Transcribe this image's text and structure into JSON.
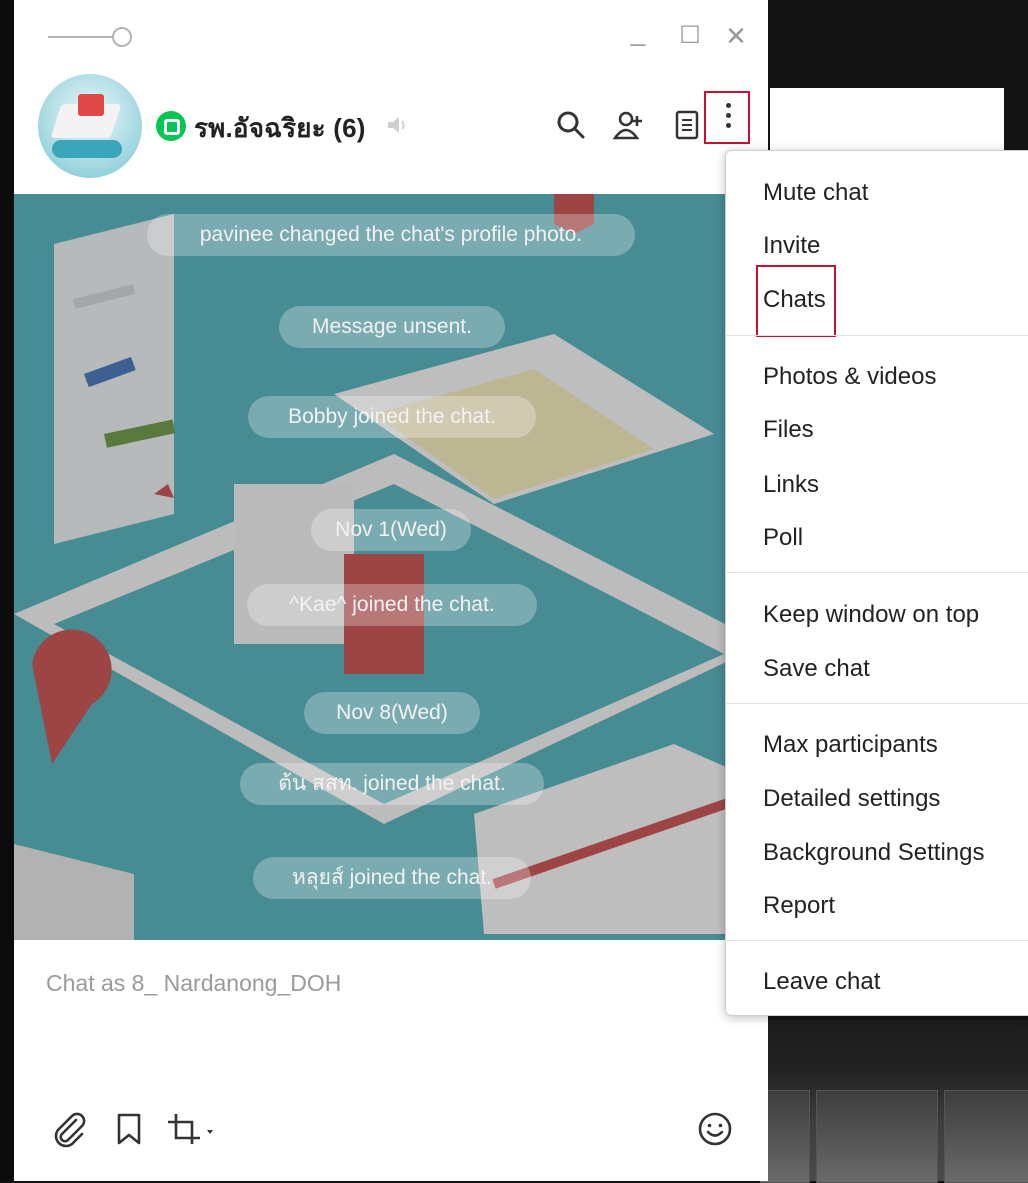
{
  "window": {
    "minimize_glyph": "_",
    "maximize_glyph": "☐",
    "close_glyph": "✕"
  },
  "header": {
    "title": "รพ.อัจฉริยะ (6)",
    "icons": [
      "search-icon",
      "add-member-icon",
      "notes-icon",
      "more-options-icon"
    ]
  },
  "messages": [
    {
      "text": "pavinee changed the chat's profile photo."
    },
    {
      "text": "Message unsent."
    },
    {
      "text": "Bobby joined the chat."
    },
    {
      "text": "Nov 1(Wed)"
    },
    {
      "text": "^Kae^ joined the chat."
    },
    {
      "text": "Nov 8(Wed)"
    },
    {
      "text": "ต้น สสท. joined the chat."
    },
    {
      "text": "หลุยส์ joined the chat."
    }
  ],
  "input": {
    "placeholder": "Chat as 8_ Nardanong_DOH"
  },
  "toolbar_icons": [
    "attach-icon",
    "bookmark-icon",
    "crop-icon",
    "emoji-icon"
  ],
  "menu": {
    "items": [
      {
        "label": "Mute chat"
      },
      {
        "label": "Invite"
      },
      {
        "label": "Chats"
      },
      {
        "label": "Photos & videos"
      },
      {
        "label": "Files"
      },
      {
        "label": "Links"
      },
      {
        "label": "Poll"
      },
      {
        "label": "Keep window on top"
      },
      {
        "label": "Save chat"
      },
      {
        "label": "Max participants"
      },
      {
        "label": "Detailed settings"
      },
      {
        "label": "Background Settings"
      },
      {
        "label": "Report"
      },
      {
        "label": "Leave chat"
      }
    ]
  },
  "colors": {
    "highlight": "#c8102e",
    "line_green": "#06c755",
    "chat_bg": "#3ea7b3"
  }
}
